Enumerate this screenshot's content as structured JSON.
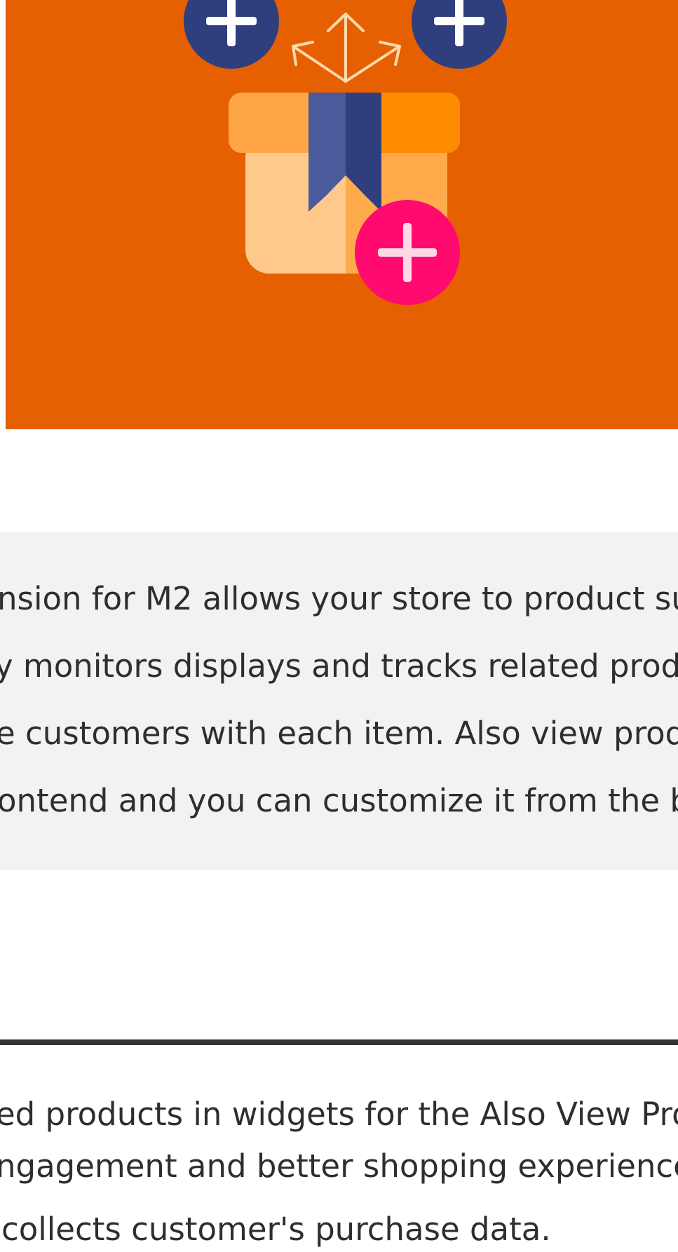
{
  "hero": {
    "background_color": "#e65f00",
    "icons": [
      "plus-icon",
      "plus-icon",
      "arrows-icon",
      "box-icon",
      "plus-icon"
    ]
  },
  "description": {
    "lines": [
      "nsion for M2 allows your store to product su",
      "y monitors displays and tracks related produ",
      "e customers with each item. Also view prod",
      "ontend and you can customize it from the ba"
    ]
  },
  "details": {
    "lines": [
      "ed products in widgets for the Also View Pro",
      "ngagement and better shopping experience",
      "collects customer's purchase data."
    ]
  }
}
